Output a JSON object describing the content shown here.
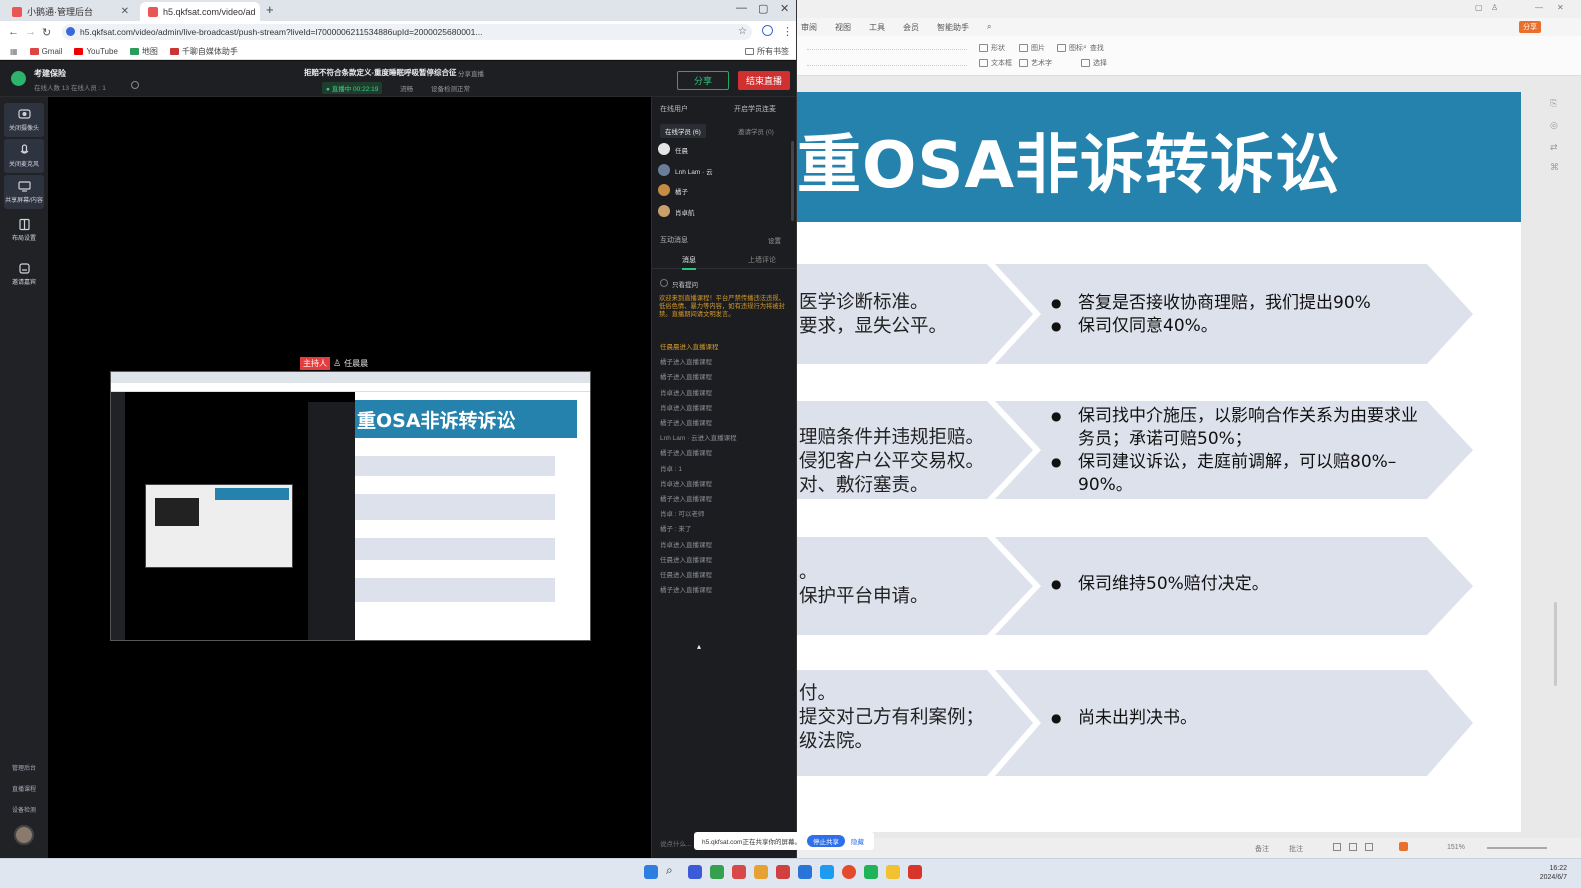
{
  "browser": {
    "tabs": [
      {
        "label": "小鹅通·管理后台",
        "active": false
      },
      {
        "label": "h5.qkfsat.com/video/ad",
        "active": true
      }
    ],
    "new_tab": "+",
    "url": "h5.qkfsat.com/video/admin/live-broadcast/push-stream?liveId=l7000006211534886upId=2000025680001...",
    "bookmarks": [
      "Gmail",
      "YouTube",
      "地图",
      "千聊自媒体助手"
    ],
    "all_bookmarks": "所有书签"
  },
  "app": {
    "brand": "考建保险",
    "meta_left": "在线人数  13    在线人员 : 1",
    "room_title": "拒赔不符合条款定义-重度睡眠呼吸暂停综合征",
    "room_share": "分享直播",
    "status_live": "● 直播中 00:22:19",
    "status_bitrate": "流畅",
    "status_device": "设备检测正常",
    "btn_share": "分享",
    "btn_end": "结束直播",
    "rail": [
      {
        "label": "关闭摄像头",
        "icon": "camera-icon"
      },
      {
        "label": "关闭麦克风",
        "icon": "mic-icon"
      },
      {
        "label": "共享屏幕/内容",
        "icon": "screen-share-icon"
      },
      {
        "label": "布局设置",
        "icon": "layout-icon"
      },
      {
        "label": "邀请嘉宾",
        "icon": "guest-icon"
      }
    ],
    "rail_bottom": [
      "管理后台",
      "直播课程",
      "设备检测"
    ],
    "presenter_tag": "主持人",
    "presenter_name": "任晨晨"
  },
  "chat": {
    "online_header": "在线用户",
    "online_tab": "在线学员 (6)",
    "invited_tab": "邀请学员 (0)",
    "viewers_btn": "开启学员连麦",
    "users": [
      "任晨",
      "Lnh Lam · 云",
      "橘子",
      "肖卓航"
    ],
    "interaction_title": "互动消息",
    "settings": "设置",
    "tab_all": "消息",
    "tab_comments": "上墙评论",
    "only_teacher": "只看提问",
    "notice": "欢迎来到直播课程！平台严禁传播违法违规、低俗色情、暴力等内容，如有违规行为将被封禁。直播期间请文明发言。",
    "messages": [
      "任晨晨进入直播课程",
      "橘子进入直播课程",
      "橘子进入直播课程",
      "肖卓进入直播课程",
      "肖卓进入直播课程",
      "橘子进入直播课程",
      "Lnh Lam · 云进入直播课程",
      "橘子进入直播课程",
      "肖卓 : 1",
      "肖卓进入直播课程",
      "橘子进入直播课程",
      "肖卓 : 可以老师",
      "橘子 : 来了",
      "肖卓进入直播课程",
      "任晨进入直播课程",
      "任晨进入直播课程",
      "橘子进入直播课程"
    ],
    "input_placeholder": "说点什么..."
  },
  "toast": {
    "text": "h5.qkfsat.com正在共享你的屏幕。",
    "stop": "停止共享",
    "hide": "隐藏"
  },
  "editor": {
    "menus": [
      "审阅",
      "视图",
      "工具",
      "会员",
      "智能助手"
    ],
    "ribbon": [
      "形状",
      "图片",
      "图标",
      "文本框",
      "艺术字",
      "查找",
      "替换",
      "选择"
    ],
    "share_btn": "分享",
    "slide": {
      "title": "重OSA非诉转诉讼",
      "rows": [
        {
          "left": [
            "医学诊断标准。",
            "要求，显失公平。"
          ],
          "right": [
            "答复是否接收协商理赔，我们提出90%",
            "保司仅同意40%。"
          ]
        },
        {
          "left": [
            "理赔条件并违规拒赔。",
            "侵犯客户公平交易权。",
            "对、敷衍塞责。"
          ],
          "right": [
            "保司找中介施压，以影响合作关系为由要求业务员；承诺可赔50%；",
            "保司建议诉讼，走庭前调解，可以赔80%–90%。"
          ]
        },
        {
          "left": [
            "。",
            "保护平台申请。"
          ],
          "right": [
            "保司维持50%赔付决定。"
          ]
        },
        {
          "left": [
            "付。",
            "提交对己方有利案例；",
            "级法院。"
          ],
          "right": [
            "尚未出判决书。"
          ]
        }
      ]
    },
    "statusbar": [
      "备注",
      "批注"
    ],
    "zoom": "151%"
  },
  "taskbar": {
    "time": "16:22",
    "date": "2024/6/7"
  },
  "colors": {
    "slide_banner": "#2582ac",
    "chevron": "#dde1ec",
    "end_live": "#d03030",
    "share_green": "#2ec27a",
    "presenter_tag": "#e53d3d"
  }
}
